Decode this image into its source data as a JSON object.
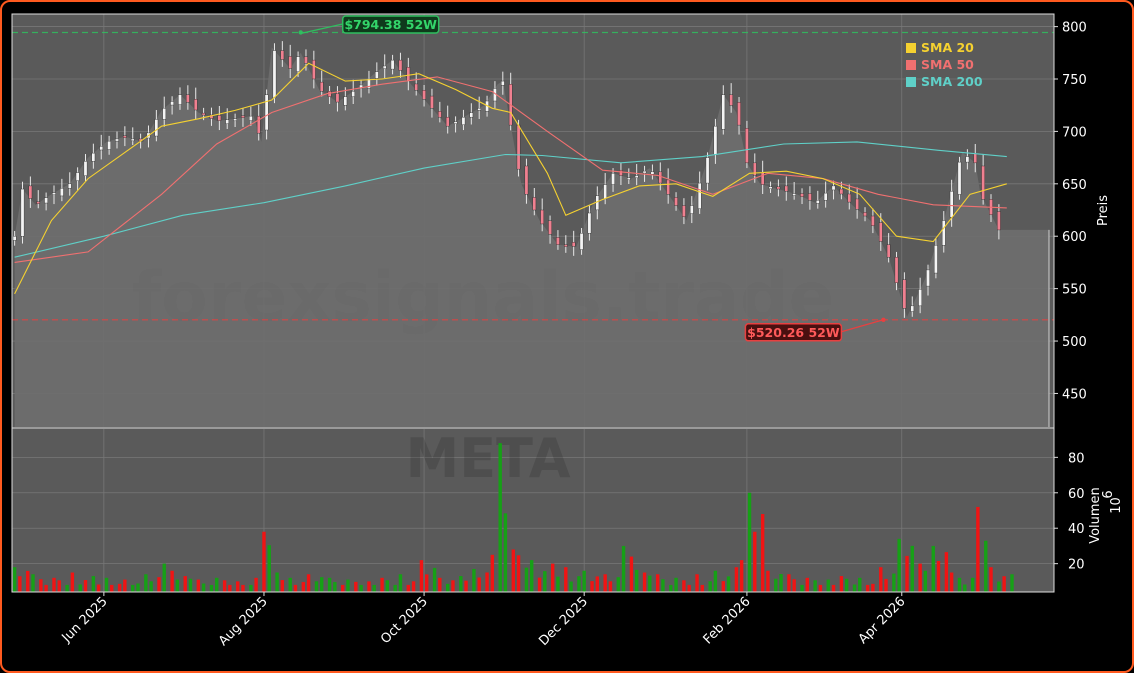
{
  "chart_data": {
    "type": "candlestick",
    "symbol_watermark": "META",
    "site_watermark": "forexsignals.trade",
    "price_axis": {
      "label": "Preis",
      "ylim": [
        418,
        812
      ],
      "ticks": [
        450,
        500,
        550,
        600,
        650,
        700,
        750,
        800
      ]
    },
    "volume_axis": {
      "label": "Volumen",
      "unit_label": "10",
      "unit_exp": "6",
      "ylim": [
        4,
        96
      ],
      "ticks": [
        20,
        40,
        60,
        80
      ]
    },
    "x_axis": {
      "range": [
        "2025-04-27",
        "2026-05-29"
      ],
      "ticks": [
        {
          "date": "2025-06-01",
          "label": "Jun 2025"
        },
        {
          "date": "2025-08-01",
          "label": "Aug 2025"
        },
        {
          "date": "2025-10-01",
          "label": "Oct 2025"
        },
        {
          "date": "2025-12-01",
          "label": "Dec 2025"
        },
        {
          "date": "2026-02-01",
          "label": "Feb 2026"
        },
        {
          "date": "2026-04-01",
          "label": "Apr 2026"
        }
      ]
    },
    "grid": true,
    "legend_position": "top-right",
    "legend": [
      {
        "name": "SMA 20",
        "color": "#f5d130"
      },
      {
        "name": "SMA 50",
        "color": "#f07070"
      },
      {
        "name": "SMA 200",
        "color": "#5fd0c8"
      }
    ],
    "annotations": [
      {
        "text": "$794.38 52W",
        "date": "2025-08-15",
        "value": 794.38,
        "color": "#2fbf5f",
        "kind": "high"
      },
      {
        "text": "$520.26 52W",
        "date": "2026-03-25",
        "value": 520.26,
        "color": "#e84040",
        "kind": "low"
      }
    ],
    "last_close": 606,
    "close_series": {
      "dates": [
        "2025-04-28",
        "2025-05-01",
        "2025-05-06",
        "2025-05-12",
        "2025-05-19",
        "2025-05-26",
        "2025-06-02",
        "2025-06-09",
        "2025-06-16",
        "2025-06-23",
        "2025-06-30",
        "2025-07-07",
        "2025-07-14",
        "2025-07-21",
        "2025-07-28",
        "2025-07-31",
        "2025-08-04",
        "2025-08-11",
        "2025-08-15",
        "2025-08-22",
        "2025-08-29",
        "2025-09-05",
        "2025-09-12",
        "2025-09-19",
        "2025-09-26",
        "2025-10-03",
        "2025-10-10",
        "2025-10-17",
        "2025-10-24",
        "2025-10-29",
        "2025-10-31",
        "2025-11-07",
        "2025-11-14",
        "2025-11-21",
        "2025-11-28",
        "2025-12-05",
        "2025-12-12",
        "2025-12-19",
        "2025-12-26",
        "2026-01-02",
        "2026-01-09",
        "2026-01-16",
        "2026-01-23",
        "2026-01-28",
        "2026-02-01",
        "2026-02-06",
        "2026-02-13",
        "2026-02-20",
        "2026-02-27",
        "2026-03-06",
        "2026-03-13",
        "2026-03-20",
        "2026-03-27",
        "2026-04-03",
        "2026-04-10",
        "2026-04-17",
        "2026-04-24",
        "2026-04-29",
        "2026-05-01",
        "2026-05-08"
      ],
      "values": [
        600,
        645,
        630,
        640,
        650,
        675,
        690,
        695,
        690,
        720,
        735,
        718,
        710,
        712,
        715,
        690,
        780,
        760,
        775,
        740,
        728,
        740,
        755,
        768,
        745,
        725,
        705,
        715,
        725,
        745,
        748,
        650,
        615,
        592,
        590,
        635,
        660,
        655,
        665,
        640,
        615,
        665,
        735,
        718,
        670,
        650,
        645,
        640,
        632,
        648,
        630,
        615,
        580,
        523,
        560,
        615,
        680,
        670,
        640,
        606
      ]
    },
    "sma20": {
      "dates": [
        "2025-04-28",
        "2025-05-12",
        "2025-05-26",
        "2025-06-09",
        "2025-06-23",
        "2025-07-07",
        "2025-07-21",
        "2025-08-04",
        "2025-08-18",
        "2025-09-01",
        "2025-09-15",
        "2025-09-29",
        "2025-10-13",
        "2025-10-27",
        "2025-11-03",
        "2025-11-17",
        "2025-11-24",
        "2025-12-08",
        "2025-12-22",
        "2026-01-05",
        "2026-01-19",
        "2026-02-02",
        "2026-02-16",
        "2026-03-02",
        "2026-03-16",
        "2026-03-30",
        "2026-04-13",
        "2026-04-27",
        "2026-05-11"
      ],
      "values": [
        545,
        615,
        655,
        680,
        705,
        712,
        720,
        730,
        765,
        748,
        750,
        755,
        740,
        722,
        718,
        660,
        620,
        635,
        648,
        650,
        638,
        660,
        662,
        655,
        640,
        600,
        595,
        640,
        650
      ]
    },
    "sma50": {
      "dates": [
        "2025-04-28",
        "2025-05-26",
        "2025-06-23",
        "2025-07-14",
        "2025-08-04",
        "2025-08-25",
        "2025-09-15",
        "2025-10-06",
        "2025-10-27",
        "2025-11-17",
        "2025-12-08",
        "2025-12-29",
        "2026-01-19",
        "2026-02-09",
        "2026-03-02",
        "2026-03-23",
        "2026-04-13",
        "2026-05-11"
      ],
      "values": [
        575,
        585,
        640,
        688,
        718,
        736,
        745,
        752,
        738,
        700,
        663,
        658,
        640,
        660,
        655,
        640,
        630,
        627
      ]
    },
    "sma200": {
      "dates": [
        "2025-04-28",
        "2025-06-01",
        "2025-07-01",
        "2025-08-01",
        "2025-09-01",
        "2025-10-01",
        "2025-11-01",
        "2025-11-15",
        "2025-12-15",
        "2026-01-15",
        "2026-02-15",
        "2026-03-15",
        "2026-04-15",
        "2026-05-11"
      ],
      "values": [
        580,
        600,
        620,
        632,
        648,
        665,
        678,
        677,
        670,
        676,
        688,
        690,
        682,
        676
      ]
    },
    "volume_series": {
      "dates": [
        "2025-04-28",
        "2025-05-05",
        "2025-05-12",
        "2025-05-19",
        "2025-05-26",
        "2025-06-02",
        "2025-06-09",
        "2025-06-16",
        "2025-06-23",
        "2025-06-30",
        "2025-07-07",
        "2025-07-14",
        "2025-07-21",
        "2025-07-28",
        "2025-07-31",
        "2025-08-04",
        "2025-08-11",
        "2025-08-18",
        "2025-08-25",
        "2025-09-01",
        "2025-09-08",
        "2025-09-15",
        "2025-09-22",
        "2025-09-29",
        "2025-10-06",
        "2025-10-13",
        "2025-10-20",
        "2025-10-27",
        "2025-10-30",
        "2025-11-03",
        "2025-11-10",
        "2025-11-17",
        "2025-11-24",
        "2025-12-01",
        "2025-12-08",
        "2025-12-15",
        "2025-12-22",
        "2025-12-29",
        "2026-01-05",
        "2026-01-12",
        "2026-01-19",
        "2026-01-26",
        "2026-01-29",
        "2026-02-02",
        "2026-02-09",
        "2026-02-16",
        "2026-02-23",
        "2026-03-02",
        "2026-03-09",
        "2026-03-16",
        "2026-03-23",
        "2026-03-30",
        "2026-04-06",
        "2026-04-13",
        "2026-04-20",
        "2026-04-27",
        "2026-04-30",
        "2026-05-04",
        "2026-05-11"
      ],
      "values": [
        18,
        14,
        12,
        15,
        13,
        12,
        11,
        14,
        20,
        13,
        11,
        12,
        10,
        12,
        38,
        15,
        12,
        14,
        12,
        11,
        10,
        12,
        14,
        22,
        12,
        13,
        17,
        25,
        88,
        28,
        22,
        20,
        18,
        16,
        14,
        30,
        15,
        14,
        12,
        14,
        16,
        18,
        22,
        60,
        16,
        14,
        12,
        11,
        13,
        12,
        18,
        34,
        20,
        30,
        15,
        12,
        52,
        18,
        14
      ],
      "up": [
        true,
        true,
        false,
        true,
        false,
        true,
        false,
        true,
        false,
        true,
        false,
        true,
        false,
        true,
        false,
        false,
        true,
        false,
        true,
        false,
        true,
        false,
        true,
        false,
        true,
        false,
        true,
        false,
        false,
        false,
        false,
        true,
        false,
        true,
        false,
        false,
        true,
        false,
        true,
        false,
        false,
        true,
        false,
        true,
        false,
        false,
        true,
        false,
        false,
        true,
        false,
        false,
        true,
        true,
        false,
        true,
        false,
        true,
        false
      ]
    }
  }
}
